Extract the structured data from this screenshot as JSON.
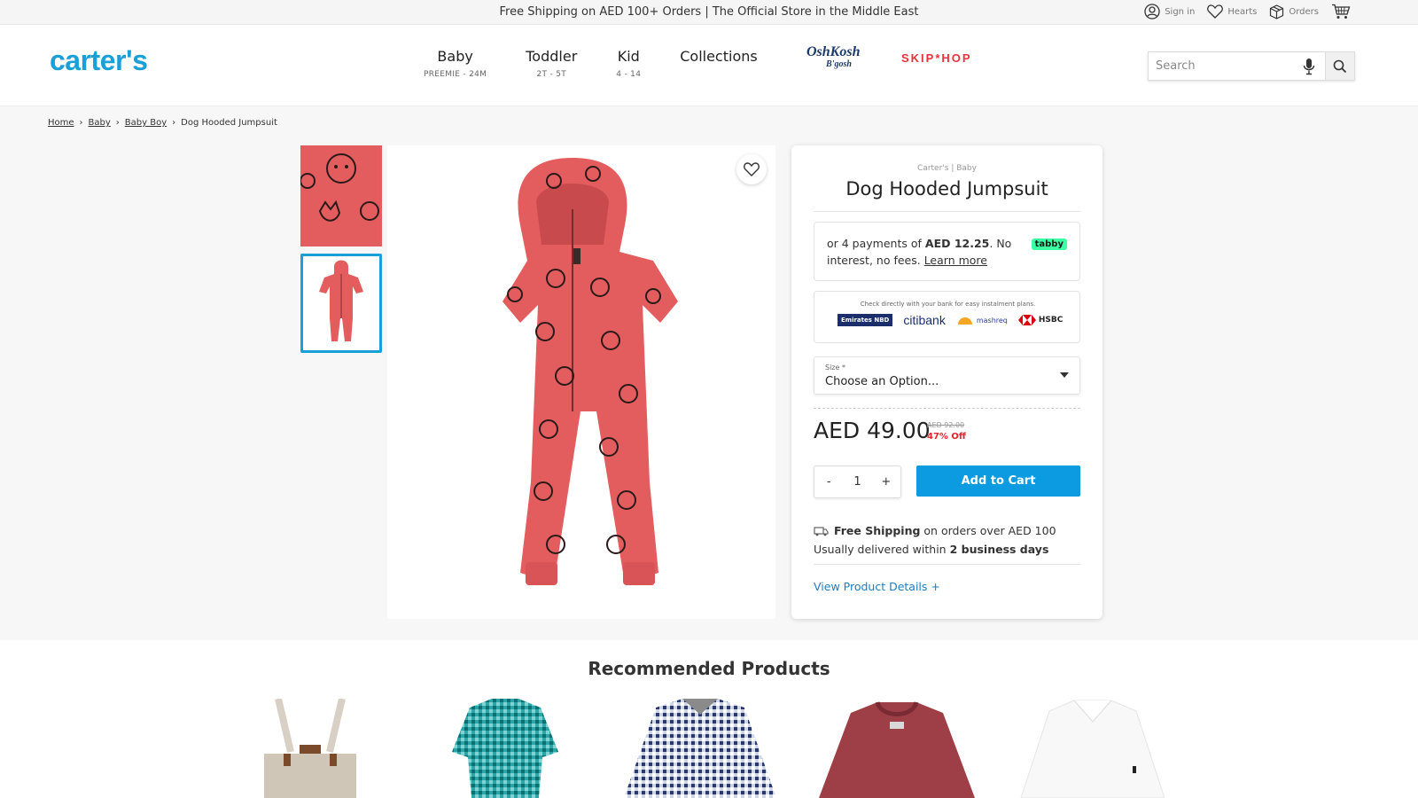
{
  "topbar": {
    "promo": "Free Shipping on AED 100+ Orders | The Official Store in the Middle East",
    "links": [
      {
        "label": "Sign in",
        "icon": "user-icon"
      },
      {
        "label": "Hearts",
        "icon": "heart-icon"
      },
      {
        "label": "Orders",
        "icon": "box-icon"
      },
      {
        "label": "",
        "icon": "cart-icon"
      }
    ]
  },
  "header": {
    "logo": "carter's",
    "nav": [
      {
        "title": "Baby",
        "sub": "PREEMIE - 24M"
      },
      {
        "title": "Toddler",
        "sub": "2T - 5T"
      },
      {
        "title": "Kid",
        "sub": "4 - 14"
      },
      {
        "title": "Collections",
        "sub": ""
      }
    ],
    "oshkosh": "OshKosh",
    "oshkosh_sub": "B'gosh",
    "skiphop": "SKIP*HOP",
    "search_placeholder": "Search"
  },
  "breadcrumb": [
    "Home",
    "Baby",
    "Baby Boy",
    "Dog Hooded Jumpsuit"
  ],
  "product": {
    "brand_line": "Carter's | Baby",
    "title": "Dog Hooded Jumpsuit",
    "tabby_prefix": "or 4 payments of ",
    "tabby_amount": "AED 12.25",
    "tabby_suffix": ". No interest, no fees. ",
    "tabby_link": "Learn more",
    "tabby_badge": "tabby",
    "banks_note": "Check directly with your bank for easy instalment plans.",
    "banks": [
      "Emirates NBD",
      "citibank",
      "mashreq",
      "HSBC"
    ],
    "size_label": "Size *",
    "size_value": "Choose an Option...",
    "price": "AED 49.00",
    "old_price": "AED 92.00",
    "discount": "47% Off",
    "qty_minus": "-",
    "qty_value": "1",
    "qty_plus": "+",
    "add_to_cart": "Add to Cart",
    "ship_bold": "Free Shipping",
    "ship_rest": " on orders over AED 100",
    "delivery_prefix": "Usually delivered within ",
    "delivery_bold": "2 business days",
    "details_link": "View Product Details +"
  },
  "recommended": {
    "title": "Recommended Products"
  },
  "colors": {
    "brand_blue": "#1aa0d8",
    "cta_blue": "#0c9be0",
    "sale_red": "#e3242b",
    "jumpsuit_red": "#e35d5e"
  }
}
